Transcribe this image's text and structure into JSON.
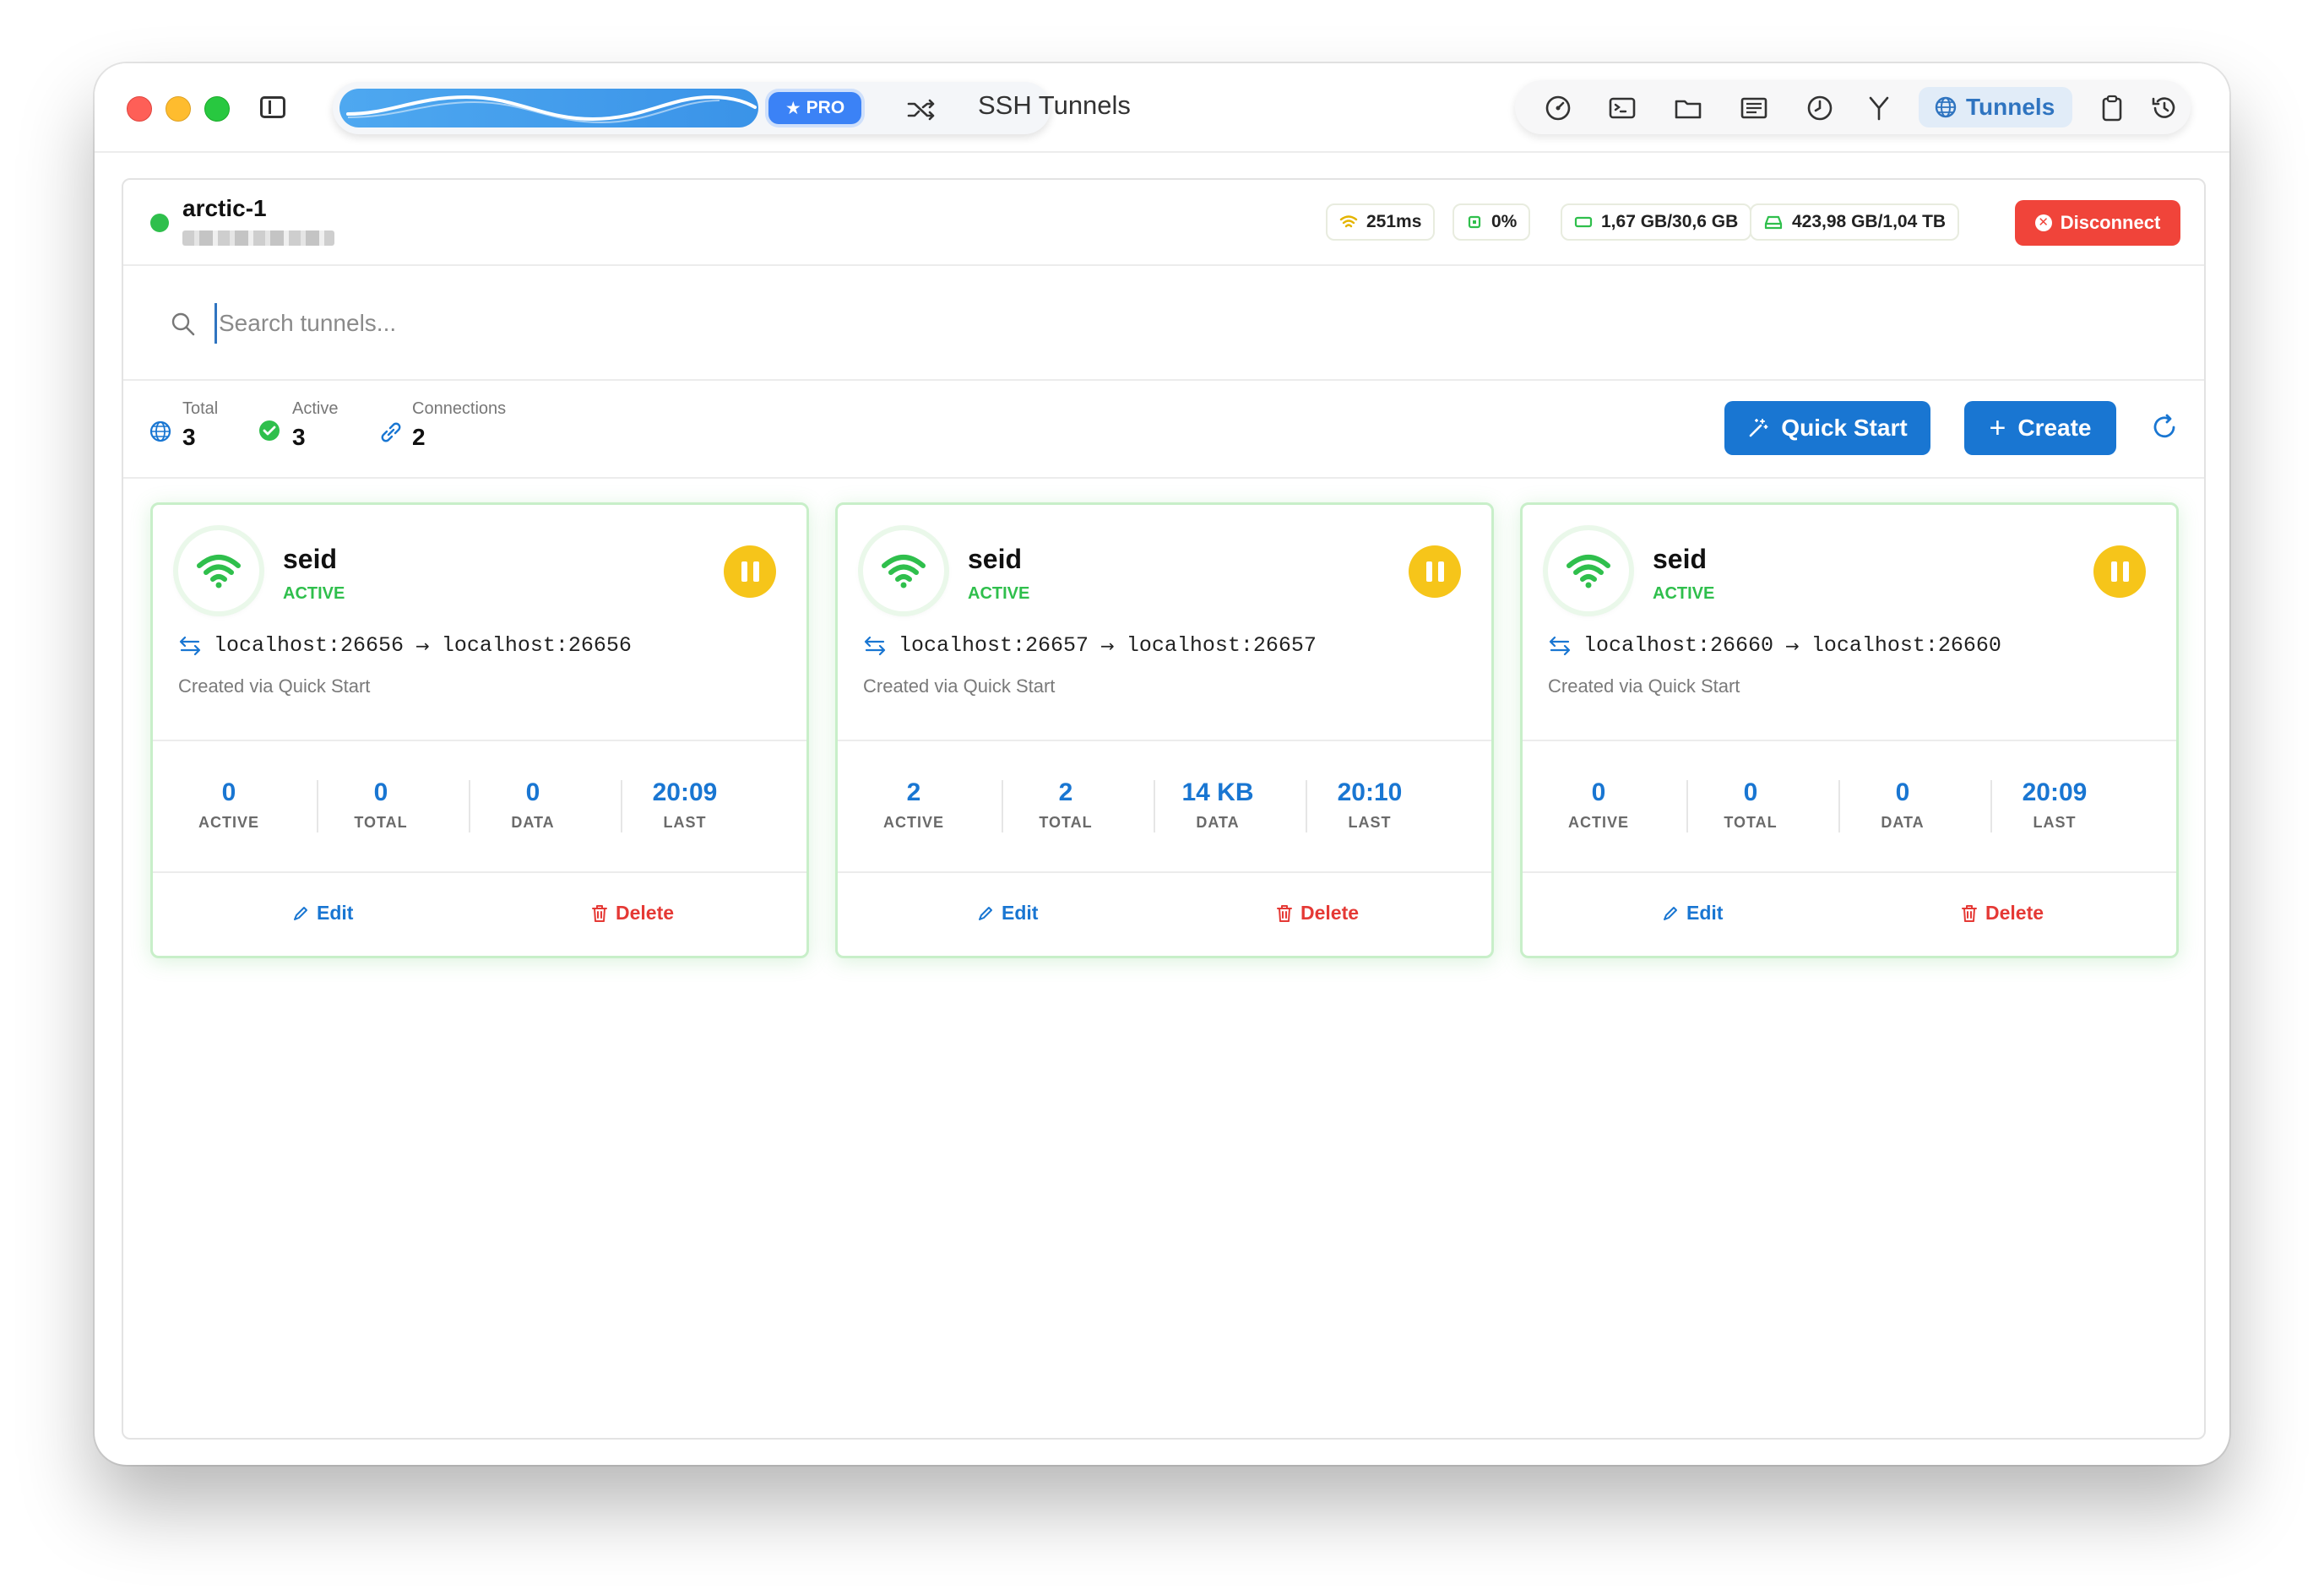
{
  "window": {
    "title": "SSH Tunnels",
    "pro_badge": "PRO",
    "active_tab": "Tunnels"
  },
  "server": {
    "name": "arctic-1",
    "status": "online",
    "metrics": {
      "latency": "251ms",
      "cpu": "0%",
      "memory": "1,67 GB/30,6 GB",
      "disk": "423,98 GB/1,04 TB"
    },
    "disconnect_label": "Disconnect"
  },
  "search": {
    "placeholder": "Search tunnels..."
  },
  "summary": {
    "total_label": "Total",
    "total_value": "3",
    "active_label": "Active",
    "active_value": "3",
    "connections_label": "Connections",
    "connections_value": "2",
    "quick_start_label": "Quick Start",
    "create_label": "Create"
  },
  "tunnels": [
    {
      "name": "seid",
      "status": "ACTIVE",
      "local": "localhost:26656",
      "remote": "localhost:26656",
      "description": "Created via Quick Start",
      "stats": [
        {
          "value": "0",
          "label": "ACTIVE"
        },
        {
          "value": "0",
          "label": "TOTAL"
        },
        {
          "value": "0",
          "label": "DATA"
        },
        {
          "value": "20:09",
          "label": "LAST"
        }
      ],
      "edit_label": "Edit",
      "delete_label": "Delete"
    },
    {
      "name": "seid",
      "status": "ACTIVE",
      "local": "localhost:26657",
      "remote": "localhost:26657",
      "description": "Created via Quick Start",
      "stats": [
        {
          "value": "2",
          "label": "ACTIVE"
        },
        {
          "value": "2",
          "label": "TOTAL"
        },
        {
          "value": "14 KB",
          "label": "DATA"
        },
        {
          "value": "20:10",
          "label": "LAST"
        }
      ],
      "edit_label": "Edit",
      "delete_label": "Delete"
    },
    {
      "name": "seid",
      "status": "ACTIVE",
      "local": "localhost:26660",
      "remote": "localhost:26660",
      "description": "Created via Quick Start",
      "stats": [
        {
          "value": "0",
          "label": "ACTIVE"
        },
        {
          "value": "0",
          "label": "TOTAL"
        },
        {
          "value": "0",
          "label": "DATA"
        },
        {
          "value": "20:09",
          "label": "LAST"
        }
      ],
      "edit_label": "Edit",
      "delete_label": "Delete"
    }
  ],
  "colors": {
    "accent": "#1976d2",
    "active_green": "#2fbf4c",
    "pause_yellow": "#f6c51a",
    "danger": "#f0443a"
  }
}
